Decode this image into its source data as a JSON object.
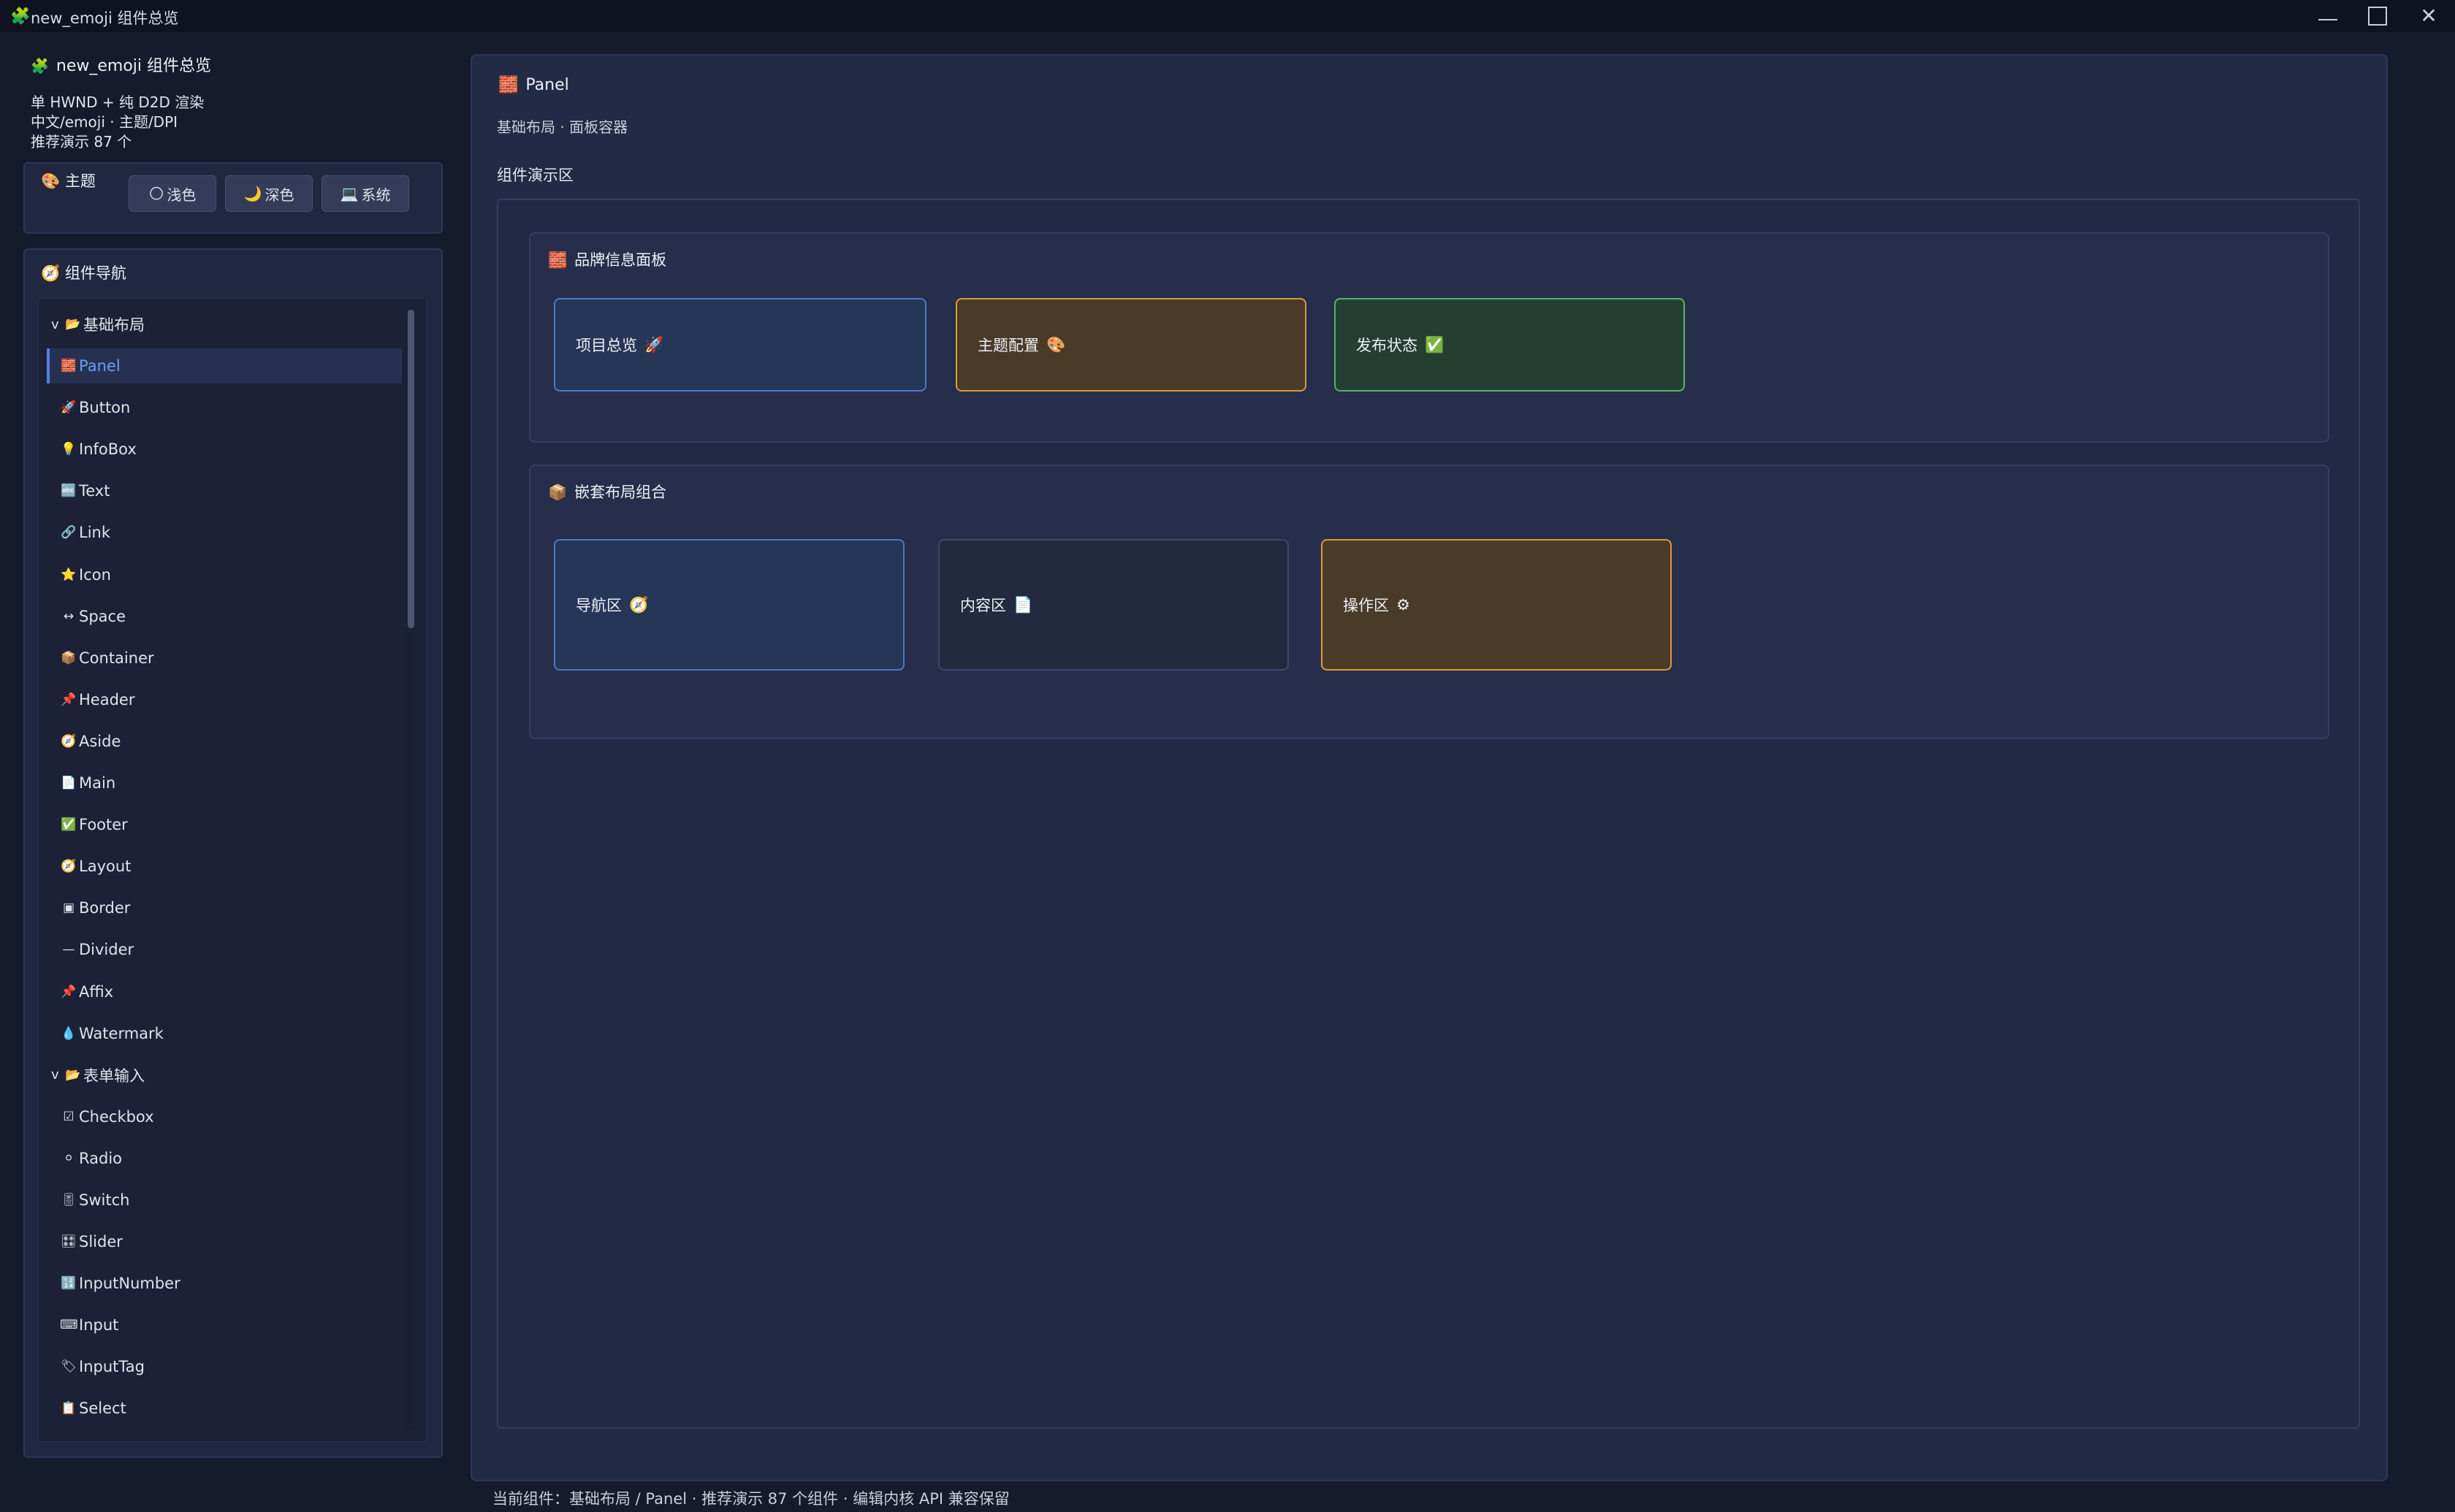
{
  "window": {
    "title": "new_emoji 组件总览",
    "app_icon": "🧩"
  },
  "sidebar": {
    "title": "new_emoji 组件总览",
    "title_icon": "🧩",
    "info": [
      "单 HWND + 纯 D2D 渲染",
      "中文/emoji · 主题/DPI",
      "推荐演示 87 个"
    ],
    "theme": {
      "icon": "🎨",
      "label": "主题",
      "buttons": [
        {
          "icon": "🌕",
          "label": "浅色"
        },
        {
          "icon": "🌙",
          "label": "深色"
        },
        {
          "icon": "💻",
          "label": "系统"
        }
      ]
    },
    "nav": {
      "icon": "🧭",
      "title": "组件导航",
      "items": [
        {
          "type": "group",
          "arrow": "v",
          "icon": "📂",
          "label": "基础布局"
        },
        {
          "type": "item",
          "icon": "🧱",
          "label": "Panel",
          "selected": true
        },
        {
          "type": "item",
          "icon": "🚀",
          "label": "Button"
        },
        {
          "type": "item",
          "icon": "💡",
          "label": "InfoBox"
        },
        {
          "type": "item",
          "icon": "🔤",
          "label": "Text"
        },
        {
          "type": "item",
          "icon": "🔗",
          "label": "Link"
        },
        {
          "type": "item",
          "icon": "⭐",
          "label": "Icon"
        },
        {
          "type": "item",
          "icon": "↔",
          "label": "Space"
        },
        {
          "type": "item",
          "icon": "📦",
          "label": "Container"
        },
        {
          "type": "item",
          "icon": "📌",
          "label": "Header"
        },
        {
          "type": "item",
          "icon": "🧭",
          "label": "Aside"
        },
        {
          "type": "item",
          "icon": "📄",
          "label": "Main"
        },
        {
          "type": "item",
          "icon": "✅",
          "label": "Footer"
        },
        {
          "type": "item",
          "icon": "🧭",
          "label": "Layout"
        },
        {
          "type": "item",
          "icon": "▣",
          "label": "Border"
        },
        {
          "type": "item",
          "icon": "—",
          "label": "Divider"
        },
        {
          "type": "item",
          "icon": "📌",
          "label": "Affix"
        },
        {
          "type": "item",
          "icon": "💧",
          "label": "Watermark"
        },
        {
          "type": "group",
          "arrow": "v",
          "icon": "📂",
          "label": "表单输入"
        },
        {
          "type": "item",
          "icon": "☑",
          "label": "Checkbox"
        },
        {
          "type": "item",
          "icon": "⚪",
          "label": "Radio"
        },
        {
          "type": "item",
          "icon": "🎚",
          "label": "Switch"
        },
        {
          "type": "item",
          "icon": "🎛",
          "label": "Slider"
        },
        {
          "type": "item",
          "icon": "🔢",
          "label": "InputNumber"
        },
        {
          "type": "item",
          "icon": "⌨",
          "label": "Input"
        },
        {
          "type": "item",
          "icon": "🏷",
          "label": "InputTag"
        },
        {
          "type": "item",
          "icon": "📋",
          "label": "Select"
        }
      ]
    }
  },
  "main": {
    "title_icon": "🧱",
    "title": "Panel",
    "subtitle": "基础布局 · 面板容器",
    "demo_label": "组件演示区",
    "sections": [
      {
        "icon": "🧱",
        "title": "品牌信息面板",
        "boxes": [
          {
            "label": "项目总览",
            "icon": "🚀",
            "style": "blue"
          },
          {
            "label": "主题配置",
            "icon": "🎨",
            "style": "orange"
          },
          {
            "label": "发布状态",
            "icon": "✅",
            "style": "green"
          }
        ]
      },
      {
        "icon": "📦",
        "title": "嵌套布局组合",
        "boxes": [
          {
            "label": "导航区",
            "icon": "🧭",
            "style": "blue"
          },
          {
            "label": "内容区",
            "icon": "📄",
            "style": "dark"
          },
          {
            "label": "操作区",
            "icon": "⚙",
            "style": "orange"
          }
        ]
      }
    ]
  },
  "statusbar": {
    "text": "当前组件：基础布局 / Panel · 推荐演示 87 个组件 · 编辑内核 API 兼容保留"
  },
  "colors": {
    "background": "#151a2c",
    "accent": "#4f7fe0",
    "selected_text": "#6f9df2"
  }
}
